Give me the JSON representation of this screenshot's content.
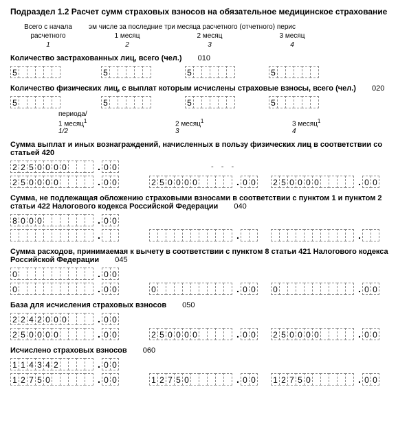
{
  "title": "Подраздел 1.2 Расчет сумм страховых взносов на обязательное медицинское страхование",
  "headers": {
    "col1_top": "Всего с начала",
    "col1_bot": "расчетного",
    "col2_top": "эм числе за последние три месяца расчетного (отчетного) перис",
    "m1": "1 месяц",
    "m2": "2 месяц",
    "m3": "3 месяц",
    "n1": "1",
    "n2": "2",
    "n3": "3",
    "n4": "4"
  },
  "row010": {
    "label": "Количество застрахованных лиц, всего (чел.)",
    "code": "010",
    "v1": "5",
    "v2": "5",
    "v3": "5",
    "v4": "5"
  },
  "row020": {
    "label": "Количество физических лиц, с выплат которым исчислены страховые взносы, всего (чел.)",
    "code": "020",
    "v1": "5",
    "v2": "5",
    "v3": "5",
    "v4": "5"
  },
  "period2": {
    "lbl": "периода/",
    "m1": "1 месяц",
    "m2": "2 месяц",
    "m3": "3 месяц",
    "sup": "1",
    "half": "1/2"
  },
  "row030": {
    "label": "Сумма выплат и иных вознаграждений, начисленных в пользу физических лиц в соответствии со статьей 420",
    "r1_int": "2250000",
    "r1_dec": "00",
    "r2_int": "250000",
    "r2_dec": "00",
    "m1_int": "250000",
    "m1_dec": "00",
    "m2_int": "250000",
    "m2_dec": "00"
  },
  "row040": {
    "label": "Сумма, не подлежащая обложению страховыми взносами в соответствии с пунктом 1 и пунктом 2 статьи 422 Налогового кодекса Российской Федерации",
    "code": "040",
    "r1_int": "8000",
    "r1_dec": "00"
  },
  "row045": {
    "label": "Сумма расходов, принимаемая к вычету в соответствии с пунктом 8 статьи 421 Налогового кодекса Российской Федерации",
    "code": "045",
    "r1_int": "0",
    "r1_dec": "00",
    "r2_int": "0",
    "r2_dec": "00",
    "m1_int": "0",
    "m1_dec": "00",
    "m2_int": "0",
    "m2_dec": "00"
  },
  "row050": {
    "label": "База для исчисления страховых взносов",
    "code": "050",
    "r1_int": "2242000",
    "r1_dec": "00",
    "r2_int": "250000",
    "r2_dec": "00",
    "m1_int": "250000",
    "m1_dec": "00",
    "m2_int": "250000",
    "m2_dec": "00"
  },
  "row060": {
    "label": "Исчислено страховых взносов",
    "code": "060",
    "r1_int": "114342",
    "r1_dec": "00",
    "r2_int": "12750",
    "r2_dec": "00",
    "m1_int": "12750",
    "m1_dec": "00",
    "m2_int": "12750",
    "m2_dec": "00"
  }
}
